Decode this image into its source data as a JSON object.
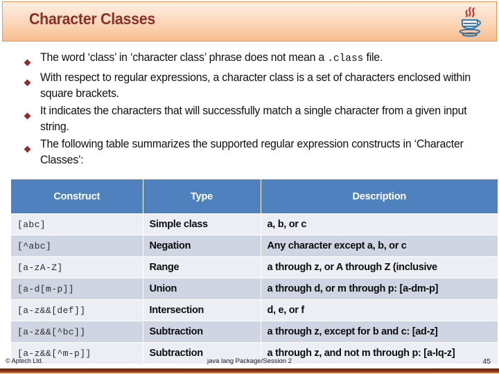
{
  "header": {
    "title": "Character Classes",
    "logo_icon": "java-coffee-cup-logo",
    "accent_color": "#8c2f2b",
    "banner_color": "#f7bd8c"
  },
  "bullets": [
    {
      "marker": "diamond-bullet-icon",
      "parts": [
        {
          "text": "The word ‘class’ in ‘character class’ phrase does not mean a ",
          "mono": false
        },
        {
          "text": ".class",
          "mono": true
        },
        {
          "text": "  file.",
          "mono": false
        }
      ]
    },
    {
      "marker": "diamond-bullet-icon",
      "parts": [
        {
          "text": "With respect to regular expressions, a character class is a set of characters enclosed within square brackets.",
          "mono": false
        }
      ]
    },
    {
      "marker": "diamond-bullet-icon",
      "parts": [
        {
          "text": "It indicates the characters that will successfully match a single character from a given input string.",
          "mono": false
        }
      ]
    },
    {
      "marker": "diamond-bullet-icon",
      "parts": [
        {
          "text": "The following table summarizes the supported regular expression constructs in ‘Character Classes’:",
          "mono": false
        }
      ]
    }
  ],
  "table": {
    "header_bg": "#4e81bd",
    "columns": [
      "Construct",
      "Type",
      "Description"
    ],
    "rows": [
      {
        "construct": "[abc]",
        "type": "Simple class",
        "description": "a, b, or c"
      },
      {
        "construct": "[^abc]",
        "type": "Negation",
        "description": "Any character except a, b, or c"
      },
      {
        "construct": "[a-zA-Z]",
        "type": "Range",
        "description": "a through z, or A through Z (inclusive"
      },
      {
        "construct": "[a-d[m-p]]",
        "type": "Union",
        "description": "a through d, or m through p: [a-dm-p]"
      },
      {
        "construct": "[a-z&&[def]]",
        "type": "Intersection",
        "description": "d, e, or f"
      },
      {
        "construct": "[a-z&&[^bc]]",
        "type": "Subtraction",
        "description": "a through z, except for b and c: [ad-z]"
      },
      {
        "construct": "[a-z&&[^m-p]]",
        "type": "Subtraction",
        "description": "a through z, and not m through p: [a-lq-z]"
      }
    ]
  },
  "footer": {
    "copyright": "© Aptech Ltd.",
    "center": "java lang Package/Session 2",
    "page_number": "45"
  }
}
